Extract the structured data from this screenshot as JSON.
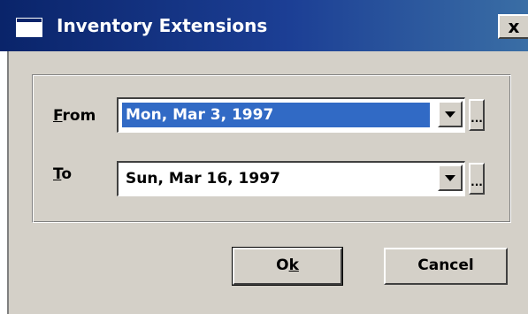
{
  "window": {
    "title": "Inventory Extensions",
    "close_label": "x"
  },
  "form": {
    "from": {
      "label_accel": "F",
      "label_rest": "rom",
      "value": "Mon, Mar 3, 1997",
      "ellipsis": "..."
    },
    "to": {
      "label_accel": "T",
      "label_rest": "o",
      "value": "Sun, Mar 16, 1997",
      "ellipsis": "..."
    }
  },
  "buttons": {
    "ok_pre": "O",
    "ok_accel": "k",
    "cancel": "Cancel"
  },
  "colors": {
    "titlebar_start": "#0a246a",
    "titlebar_end": "#3a6ea5",
    "selection": "#316ac5",
    "dialog_face": "#d4d0c8"
  }
}
